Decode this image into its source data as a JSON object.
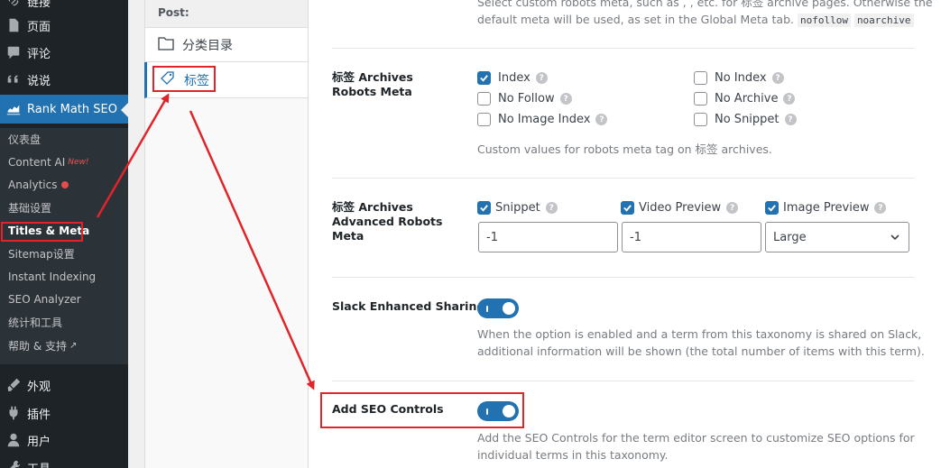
{
  "sidebar": {
    "top_items": [
      {
        "label": "链接",
        "icon": "link-icon"
      },
      {
        "label": "页面",
        "icon": "page-icon"
      },
      {
        "label": "评论",
        "icon": "comment-icon"
      },
      {
        "label": "说说",
        "icon": "quote-icon"
      },
      {
        "label": "Rank Math SEO",
        "icon": "rank-math-icon"
      }
    ],
    "sub_items": [
      "仪表盘",
      "Content AI",
      "Analytics",
      "基础设置",
      "Titles & Meta",
      "Sitemap设置",
      "Instant Indexing",
      "SEO Analyzer",
      "统计和工具",
      "帮助 & 支持"
    ],
    "new_badge": "New!",
    "bottom_items": [
      {
        "label": "外观",
        "icon": "brush-icon"
      },
      {
        "label": "插件",
        "icon": "plugin-icon"
      },
      {
        "label": "用户",
        "icon": "user-icon"
      },
      {
        "label": "工具",
        "icon": "tools-icon"
      }
    ]
  },
  "tabs": {
    "header": "Post:",
    "items": [
      {
        "label": "分类目录",
        "icon": "folder-icon"
      },
      {
        "label": "标签",
        "icon": "tag-icon"
      }
    ]
  },
  "settings": {
    "top_desc_line1": "Select custom robots meta, such as , , etc. for 标签 archive pages. Otherwise the",
    "top_desc_line2": "default meta will be used, as set in the Global Meta tab.",
    "code1": "nofollow",
    "code2": "noarchive",
    "robots": {
      "label": "标签 Archives Robots Meta",
      "options": [
        {
          "label": "Index",
          "checked": true
        },
        {
          "label": "No Index",
          "checked": false
        },
        {
          "label": "No Follow",
          "checked": false
        },
        {
          "label": "No Archive",
          "checked": false
        },
        {
          "label": "No Image Index",
          "checked": false
        },
        {
          "label": "No Snippet",
          "checked": false
        }
      ],
      "desc": "Custom values for robots meta tag on 标签 archives."
    },
    "advanced": {
      "label": "标签 Archives Advanced Robots Meta",
      "options": [
        {
          "label": "Snippet",
          "checked": true,
          "value": "-1"
        },
        {
          "label": "Video Preview",
          "checked": true,
          "value": "-1"
        },
        {
          "label": "Image Preview",
          "checked": true,
          "value": "Large"
        }
      ]
    },
    "slack": {
      "label": "Slack Enhanced Sharing",
      "enabled": true,
      "desc_line1": "When the option is enabled and a term from this taxonomy is shared on Slack,",
      "desc_line2": "additional information will be shown (the total number of items with this term)."
    },
    "seo_controls": {
      "label": "Add SEO Controls",
      "enabled": true,
      "desc_line1": "Add the SEO Controls for the term editor screen to customize SEO options for",
      "desc_line2": "individual terms in this taxonomy."
    }
  },
  "colors": {
    "accent": "#2271b1",
    "sidebar_bg": "#1d2327",
    "submenu_bg": "#2c3338",
    "annotation": "#e0242a",
    "badge_red": "#e34d4d"
  }
}
